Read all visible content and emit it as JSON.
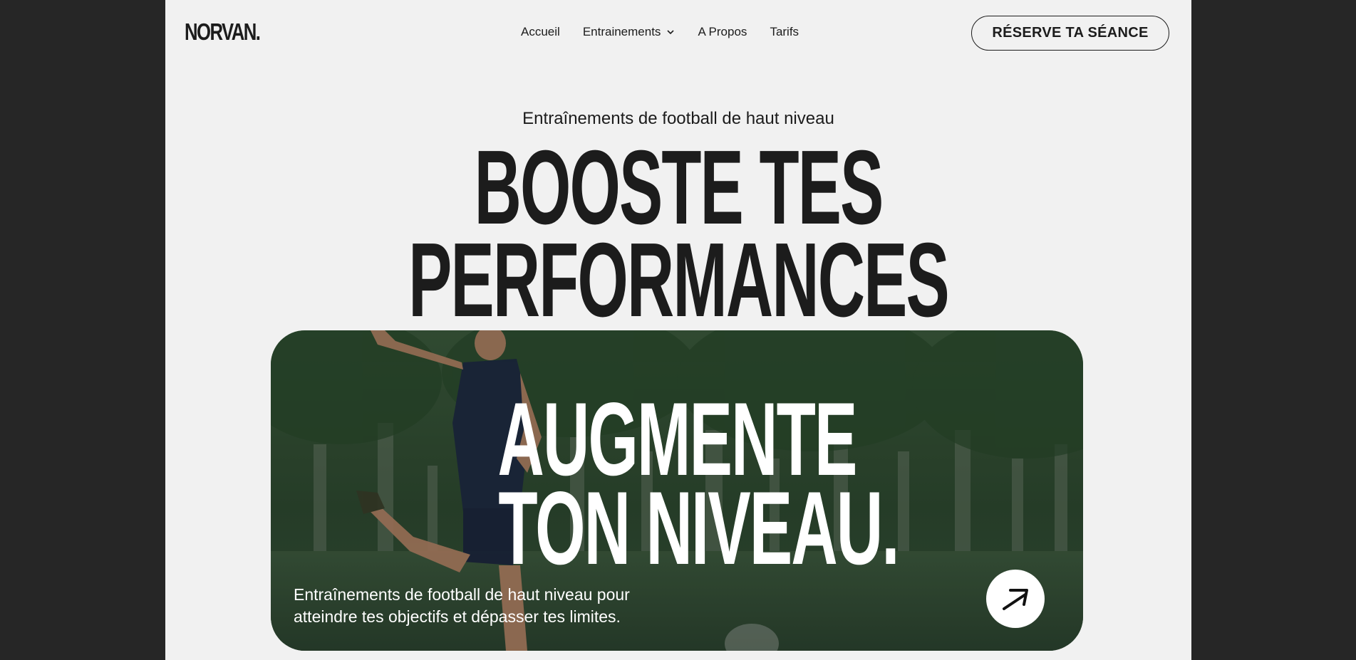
{
  "brand": {
    "logo": "NORVAN."
  },
  "nav": {
    "items": [
      {
        "label": "Accueil"
      },
      {
        "label": "Entrainements",
        "has_dropdown": true
      },
      {
        "label": "A Propos"
      },
      {
        "label": "Tarifs"
      }
    ]
  },
  "header": {
    "cta_label": "RÉSERVE TA SÉANCE"
  },
  "hero": {
    "kicker": "Entraînements de football de haut niveau",
    "title_line1": "BOOSTE TES",
    "title_line2": "PERFORMANCES"
  },
  "card": {
    "title_line1": "AUGMENTE",
    "title_line2": "TON NIVEAU.",
    "description_line1": "Entraînements de football de haut niveau pour",
    "description_line2": "atteindre tes objectifs et dépasser tes limites.",
    "arrow_icon": "arrow-up-right-icon"
  },
  "colors": {
    "outer_background": "#262626",
    "page_background": "#f1f1f1",
    "text_dark": "#1c1c1c",
    "card_overlay_green": "#2f4a35",
    "button_white": "#ffffff"
  }
}
